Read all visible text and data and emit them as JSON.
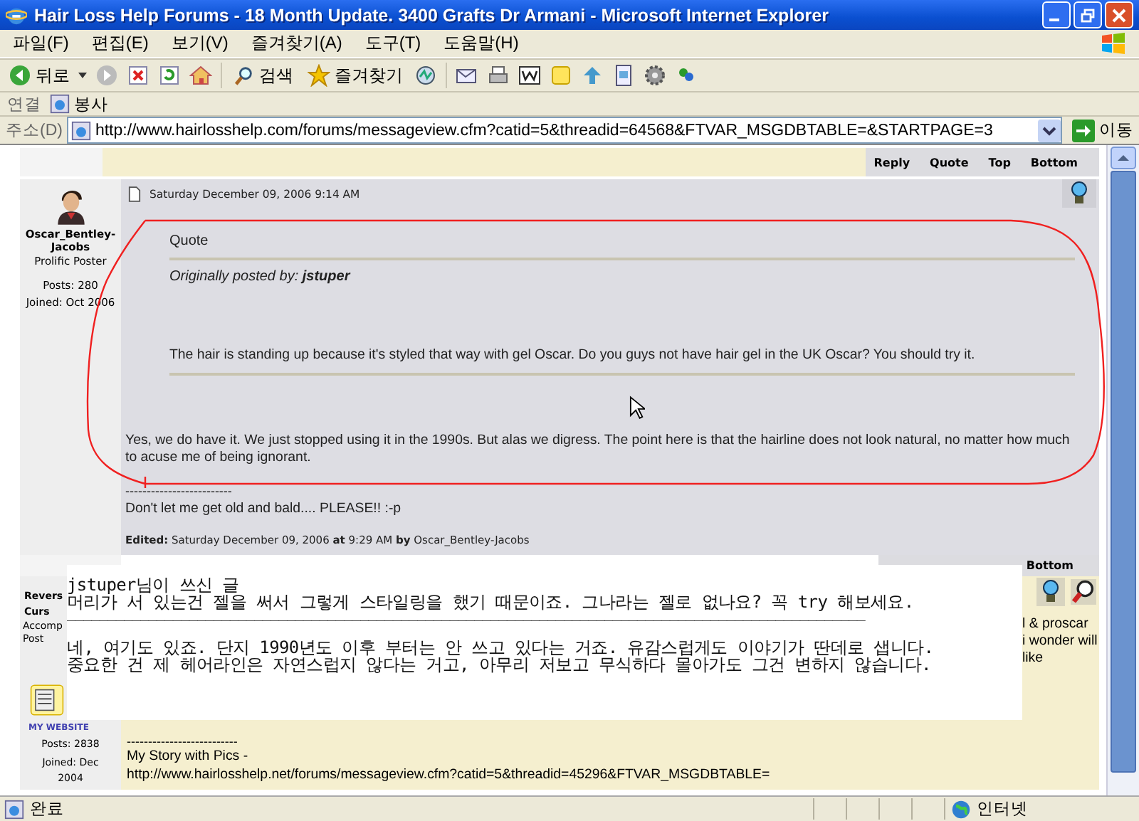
{
  "window": {
    "title": "Hair Loss Help Forums - 18 Month Update. 3400 Grafts Dr Armani - Microsoft Internet Explorer"
  },
  "menu": [
    "파일(F)",
    "편집(E)",
    "보기(V)",
    "즐겨찾기(A)",
    "도구(T)",
    "도움말(H)"
  ],
  "toolbar": {
    "back": "뒤로",
    "search": "검색",
    "favorites": "즐겨찾기"
  },
  "links_bar": {
    "label": "연결",
    "items": [
      "봉사"
    ]
  },
  "address_bar": {
    "label": "주소(D)",
    "url": "http://www.hairlosshelp.com/forums/messageview.cfm?catid=5&threadid=64568&FTVAR_MSGDBTABLE=&STARTPAGE=3",
    "go": "이동"
  },
  "post": {
    "actions": [
      "Reply",
      "Quote",
      "Top",
      "Bottom"
    ],
    "author": {
      "name": "Oscar_Bentley-Jacobs",
      "rank": "Prolific Poster",
      "posts": "Posts: 280",
      "joined": "Joined: Oct 2006"
    },
    "date": "Saturday December 09, 2006 9:14 AM",
    "quote": {
      "label": "Quote",
      "attribution": "Originally posted by: **jstuper**",
      "text": "The hair is standing up because it's styled that way with gel Oscar. Do you guys not have hair gel in the UK Oscar? You should try it."
    },
    "reply": "Yes, we do have it. We just stopped using it in the 1990s. But alas we digress. The point here is that the hairline does not look natural, no matter how much to acuse me of being ignorant.",
    "signature_rule": "-------------------------",
    "signature": "Don't let me get old and bald.... PLEASE!! :-p",
    "edited": "**Edited:** Saturday December 09, 2006 **at** 9:29 AM **by** Oscar_Bentley-Jacobs"
  },
  "next_post": {
    "actions": [
      "Bottom"
    ],
    "author_lines": [
      "Revers",
      "Curs",
      "Accomp",
      "Post"
    ],
    "website_label": "MY WEBSITE",
    "posts": "Posts: 2838",
    "joined": "Joined: Dec 2004",
    "body_fragments": [
      "l & proscar",
      "i wonder will",
      "like"
    ],
    "signature_rule": "--------------------------",
    "signature": "My Story with Pics -",
    "signature_link": "http://www.hairlosshelp.net/forums/messageview.cfm?catid=5&threadid=45296&FTVAR_MSGDBTABLE="
  },
  "translation": {
    "lines": [
      "jstuper님이 쓰신 글",
      "머리가 서 있는건 젤을 써서 그렇게 스타일링을 했기 때문이죠. 그나라는 젤로 없나요? 꼭 try 해보세요."
    ],
    "rule": "__________________________________________________________________________________________________",
    "reply_lines": [
      "네, 여기도 있죠. 단지 1990년도 이후 부터는 안 쓰고 있다는 거죠. 유감스럽게도 이야기가 딴데로 샙니다.",
      "중요한 건 제 헤어라인은 자연스럽지 않다는 거고, 아무리 저보고 무식하다 몰아가도 그건 변하지 않습니다."
    ]
  },
  "status_bar": {
    "text": "완료",
    "zone": "인터넷"
  }
}
